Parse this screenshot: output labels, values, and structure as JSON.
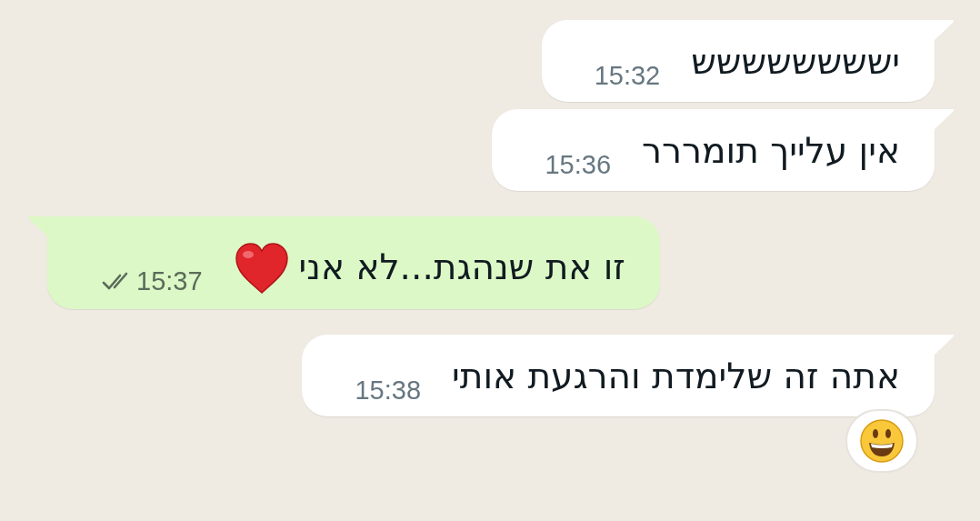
{
  "messages": [
    {
      "kind": "incoming",
      "text": "ישששששששש",
      "time": "15:32"
    },
    {
      "kind": "incoming",
      "text": "אין עלייך תומררר",
      "time": "15:36"
    },
    {
      "kind": "outgoing",
      "text": "זו את שנהגת...לא אני",
      "time": "15:37",
      "heart": true,
      "read": false
    },
    {
      "kind": "incoming",
      "text": "אתה זה שלימדת והרגעת אותי",
      "time": "15:38",
      "reaction": true
    }
  ]
}
